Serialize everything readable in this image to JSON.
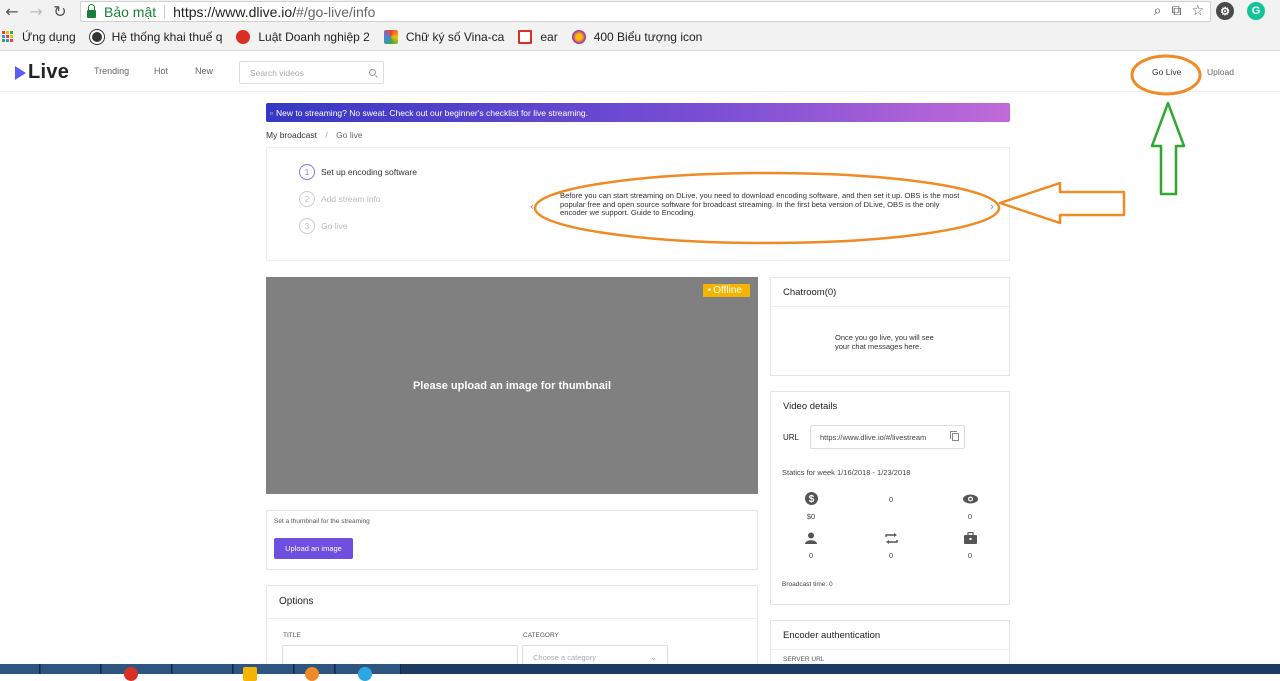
{
  "browser": {
    "security_label": "Bảo mật",
    "url_host": "https://www.dlive.io/",
    "url_path": "#/go-live/info",
    "bookmarks": [
      {
        "label": "Ứng dụng",
        "icon": "apps-grid-icon"
      },
      {
        "label": "Hệ thống khai thuế q",
        "icon": "tax-system-icon"
      },
      {
        "label": "Luật Doanh nghiệp 2",
        "icon": "law-icon"
      },
      {
        "label": "Chữ ký số Vina-ca",
        "icon": "vina-ca-icon"
      },
      {
        "label": "ear",
        "icon": "gmail-icon"
      },
      {
        "label": "400 Biểu tượng icon",
        "icon": "icons-pack-icon"
      }
    ]
  },
  "header": {
    "logo_text": "Live",
    "nav": [
      "Trending",
      "Hot",
      "New"
    ],
    "search_placeholder": "Search videos",
    "go_live": "Go Live",
    "upload": "Upload"
  },
  "banner": {
    "text": "New to streaming? No sweat. Check out our beginner's checklist for live streaming."
  },
  "breadcrumb": {
    "parent": "My broadcast",
    "separator": "/",
    "current": "Go live"
  },
  "steps": [
    {
      "number": "1",
      "label": "Set up encoding software",
      "active": true
    },
    {
      "number": "2",
      "label": "Add stream info",
      "active": false
    },
    {
      "number": "3",
      "label": "Go live",
      "active": false
    }
  ],
  "info_text": "Before you can start streaming on DLive, you need to download encoding software, and then set it up. OBS is the most popular free and open source software for broadcast streaming. In the first beta version of DLive, OBS is the only encoder we support. Guide to Encoding.",
  "thumbnail": {
    "placeholder": "Please upload an image for thumbnail",
    "status": "Offline",
    "set_label": "Set a thumbnail for the streaming",
    "upload_button": "Upload an image"
  },
  "options": {
    "title": "Options",
    "title_label": "TITLE",
    "category_label": "CATEGORY",
    "category_placeholder": "Choose a category"
  },
  "chatroom": {
    "title": "Chatroom(0)",
    "message": "Once you go live, you will see your chat messages here."
  },
  "video_details": {
    "title": "Video details",
    "url_label": "URL",
    "url_value": "https://www.dlive.io/#/livestream",
    "statics": "Statics for week 1/16/2018 - 1/23/2018",
    "stats": [
      {
        "icon": "dollar-icon",
        "value": "$0"
      },
      {
        "icon": "none",
        "value": "0"
      },
      {
        "icon": "eye-icon",
        "value": "0"
      },
      {
        "icon": "user-icon",
        "value": "0"
      },
      {
        "icon": "repeat-icon",
        "value": "0"
      },
      {
        "icon": "briefcase-icon",
        "value": "0"
      }
    ],
    "broadcast_time": "Broadcast time: 0"
  },
  "encoder": {
    "title": "Encoder authentication",
    "server_label": "SERVER URL"
  },
  "colors": {
    "brand": "#5e5cf7",
    "button": "#6e4fe0",
    "offline_badge": "#f4b400",
    "annotation_orange": "#f08a24",
    "annotation_green": "#2fa82f"
  }
}
